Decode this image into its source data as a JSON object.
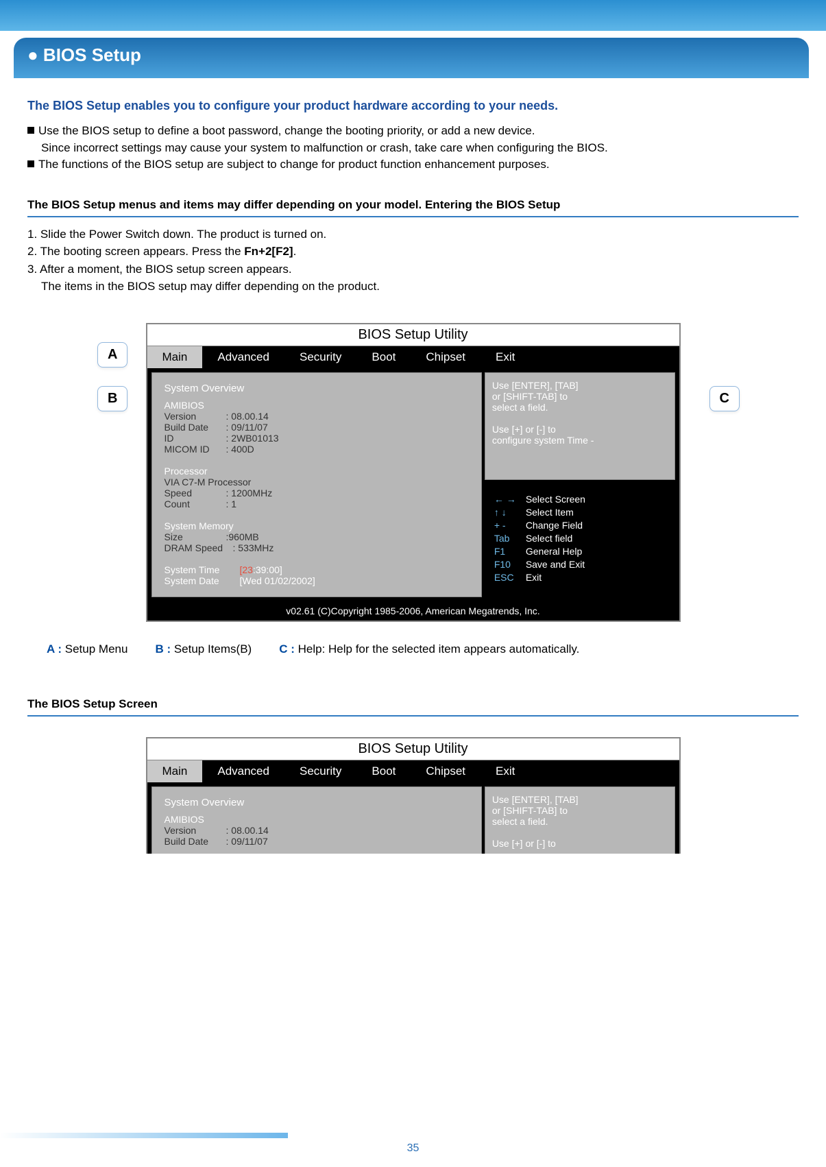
{
  "header": {
    "title": "● BIOS Setup"
  },
  "intro": {
    "title": "The BIOS Setup enables you to configure your product hardware according to your needs.",
    "b1a": "Use the BIOS setup to define a boot password, change the booting priority, or add a new device.",
    "b1b": "Since incorrect settings may cause your system to malfunction or crash, take care when configuring the BIOS.",
    "b2": "The functions of the BIOS setup are subject to change for product function enhancement purposes."
  },
  "section1": {
    "title": "The BIOS Setup menus and items may differ depending on your model. Entering the BIOS Setup",
    "s1": "1. Slide the Power Switch down. The product is turned on.",
    "s2a": "2. The booting screen appears. Press the ",
    "s2b": "Fn+2[F2]",
    "s2c": ".",
    "s3a": "3. After a moment, the BIOS setup screen appears.",
    "s3b": "The items in the BIOS setup may differ depending on the product."
  },
  "callouts": {
    "A": "A",
    "B": "B",
    "C": "C"
  },
  "bios": {
    "title": "BIOS Setup Utility",
    "tabs": {
      "main": "Main",
      "advanced": "Advanced",
      "security": "Security",
      "boot": "Boot",
      "chipset": "Chipset",
      "exit": "Exit"
    },
    "left": {
      "overview": "System Overview",
      "amibios": "AMIBIOS",
      "version_l": "Version",
      "version_v": ": 08.00.14",
      "build_l": "Build Date",
      "build_v": ": 09/11/07",
      "id_l": "ID",
      "id_v": ": 2WB01013",
      "micom_l": "MICOM ID",
      "micom_v": ": 400D",
      "proc": "Processor",
      "procname": "VIA C7-M Processor",
      "speed_l": "Speed",
      "speed_v": ": 1200MHz",
      "count_l": "Count",
      "count_v": ": 1",
      "mem": "System Memory",
      "size_l": "Size",
      "size_v": ":960MB",
      "dram_l": "DRAM Speed",
      "dram_v": ": 533MHz",
      "stime_l": "System Time",
      "stime_v1": "[23",
      "stime_v2": ":39:00]",
      "sdate_l": "System Date",
      "sdate_v": "[Wed  01/02/2002]"
    },
    "help": {
      "l1": "Use [ENTER], [TAB]",
      "l2": "or [SHIFT-TAB] to",
      "l3": "select a field.",
      "l4": "Use [+] or [-] to",
      "l5": "configure system Time -"
    },
    "keys": {
      "arrows_lr": "← →",
      "arrows_lr_t": "Select Screen",
      "arrows_ud": "↑ ↓",
      "arrows_ud_t": "Select Item",
      "pm": "+ -",
      "pm_t": "Change Field",
      "tab": "Tab",
      "tab_t": "Select field",
      "f1": "F1",
      "f1_t": "General Help",
      "f10": "F10",
      "f10_t": "Save and Exit",
      "esc": "ESC",
      "esc_t": "Exit"
    },
    "foot": "v02.61    (C)Copyright 1985-2006, American Megatrends, Inc."
  },
  "legend": {
    "a_k": "A :",
    "a_t": " Setup Menu",
    "b_k": "B :",
    "b_t": " Setup Items(B)",
    "c_k": "C :",
    "c_t": " Help: Help for the selected item appears automatically."
  },
  "section2": {
    "title": "The BIOS Setup Screen"
  },
  "page_number": "35"
}
